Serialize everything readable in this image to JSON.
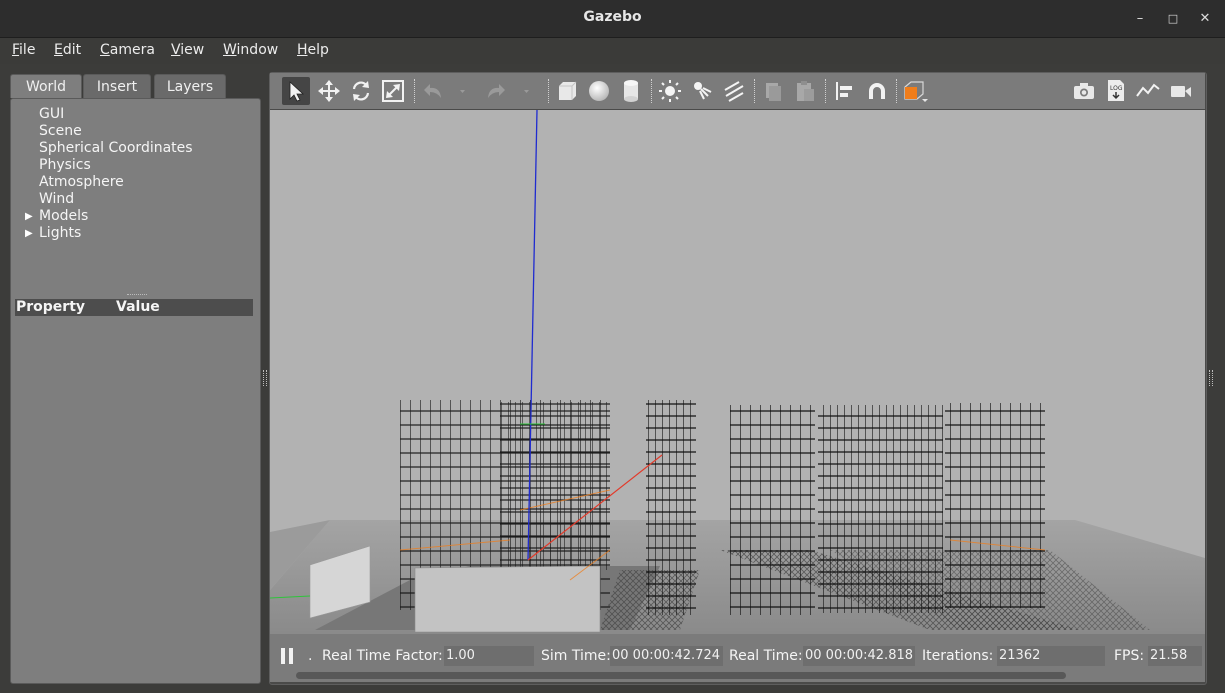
{
  "window": {
    "title": "Gazebo",
    "minimize": "–",
    "maximize": "□",
    "close": "✕"
  },
  "menu": [
    "File",
    "Edit",
    "Camera",
    "View",
    "Window",
    "Help"
  ],
  "tabs": [
    "World",
    "Insert",
    "Layers"
  ],
  "tree": [
    "GUI",
    "Scene",
    "Spherical Coordinates",
    "Physics",
    "Atmosphere",
    "Wind",
    "Models",
    "Lights"
  ],
  "property_table": {
    "col1": "Property",
    "col2": "Value"
  },
  "toolbar": {
    "icons": [
      "select-arrow-icon",
      "translate-icon",
      "rotate-icon",
      "scale-icon",
      "undo-icon",
      "undo-dropdown-icon",
      "redo-icon",
      "redo-dropdown-icon",
      "box-icon",
      "sphere-icon",
      "cylinder-icon",
      "point-light-icon",
      "spot-light-icon",
      "directional-light-icon",
      "copy-icon",
      "paste-icon",
      "align-icon",
      "snap-icon",
      "view-angle-icon",
      "screenshot-icon",
      "log-icon",
      "plot-icon",
      "record-video-icon"
    ],
    "log_label": "LOG"
  },
  "status": {
    "rtf_label": "Real Time Factor:",
    "rtf_value": "1.00",
    "sim_label": "Sim Time:",
    "sim_value": "00 00:00:42.724",
    "real_label": "Real Time:",
    "real_value": "00 00:00:42.818",
    "iter_label": "Iterations:",
    "iter_value": "21362",
    "fps_label": "FPS:",
    "fps_value": "21.58",
    "step_label": "."
  },
  "colors": {
    "accent_orange": "#f07d1a",
    "viewport_bg": "#b2b2b2",
    "axis_z": "#1f2bd0",
    "axis_x": "#e23a2a",
    "axis_y": "#2ec43a"
  }
}
